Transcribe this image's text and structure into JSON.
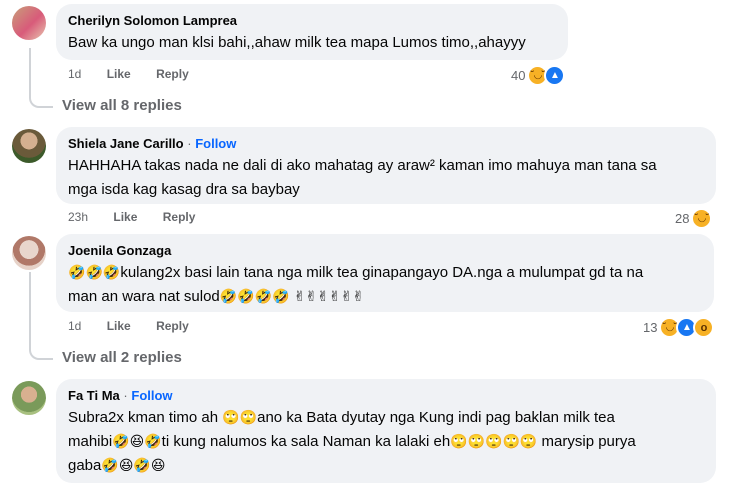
{
  "comments": [
    {
      "author": "Cherilyn Solomon Lamprea",
      "follow": "",
      "text": "Baw ka ungo man klsi bahi,,ahaw milk tea mapa Lumos timo,,ahayyy",
      "time": "1d",
      "like_label": "Like",
      "reply_label": "Reply",
      "reaction_count": "40",
      "view_replies": "View all 8 replies",
      "avatar_colors": [
        "#c8a07a",
        "#d85b7a"
      ]
    },
    {
      "author": "Shiela Jane Carillo",
      "follow": "Follow",
      "text_line1": "HAHHAHA takas nada ne dali di ako mahatag ay araw² kaman imo mahuya man tana sa",
      "text_line2": "mga isda kag kasag dra sa baybay",
      "time": "23h",
      "like_label": "Like",
      "reply_label": "Reply",
      "reaction_count": "28",
      "avatar_colors": [
        "#8a7a4a",
        "#3c5a2a"
      ]
    },
    {
      "author": "Joenila Gonzaga",
      "follow": "",
      "text_line1": "kulang2x basi lain tana nga milk tea ginapangayo DA.nga a mulumpat gd ta na",
      "text_line2": "man an wara nat sulod",
      "time": "1d",
      "like_label": "Like",
      "reply_label": "Reply",
      "reaction_count": "13",
      "view_replies": "View all 2 replies",
      "avatar_colors": [
        "#e6d2c8",
        "#8a5a4a"
      ]
    },
    {
      "author": "Fa Ti Ma",
      "follow": "Follow",
      "text_line1_a": "Subra2x kman timo ah ",
      "text_line1_b": "ano ka Bata dyutay nga Kung indi pag baklan milk tea",
      "text_line2_a": "mahibi",
      "text_line2_b": "ti kung nalumos ka sala Naman ka lalaki eh",
      "text_line2_c": " marysip purya",
      "text_line3": "gaba",
      "avatar_colors": [
        "#7a9a5a",
        "#c89060"
      ]
    }
  ],
  "icons": {
    "haha": "😆",
    "rofl": "🤣",
    "victory": "✌",
    "rolling_eyes": "🙄",
    "like": "👍",
    "wow": "😮"
  },
  "colors": {
    "bubble": "#f0f2f5",
    "follow": "#0866ff",
    "meta": "#65676b"
  }
}
